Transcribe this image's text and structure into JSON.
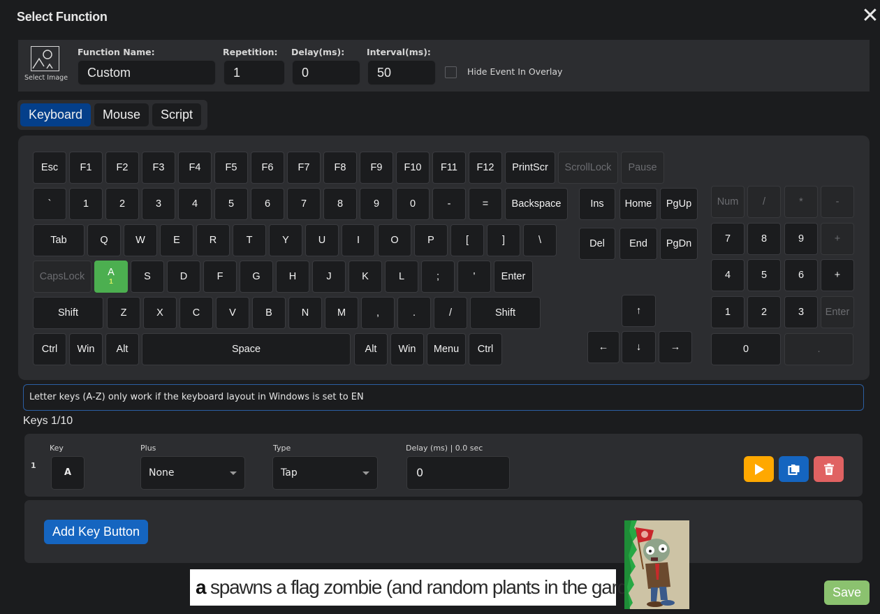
{
  "dialog": {
    "title": "Select Function",
    "close_icon": "close-icon"
  },
  "settings": {
    "select_image_label": "Select Image",
    "function_name_label": "Function Name:",
    "function_name_value": "Custom",
    "repetition_label": "Repetition:",
    "repetition_value": "1",
    "delay_label": "Delay(ms):",
    "delay_value": "0",
    "interval_label": "Interval(ms):",
    "interval_value": "50",
    "hide_event_label": "Hide Event In Overlay",
    "hide_event_checked": false
  },
  "tabs": [
    {
      "label": "Keyboard",
      "active": true
    },
    {
      "label": "Mouse",
      "active": false
    },
    {
      "label": "Script",
      "active": false
    }
  ],
  "keyboard": {
    "keys": [
      {
        "id": "esc",
        "label": "Esc"
      },
      {
        "id": "f1",
        "label": "F1"
      },
      {
        "id": "f2",
        "label": "F2"
      },
      {
        "id": "f3",
        "label": "F3"
      },
      {
        "id": "f4",
        "label": "F4"
      },
      {
        "id": "f5",
        "label": "F5"
      },
      {
        "id": "f6",
        "label": "F6"
      },
      {
        "id": "f7",
        "label": "F7"
      },
      {
        "id": "f8",
        "label": "F8"
      },
      {
        "id": "f9",
        "label": "F9"
      },
      {
        "id": "f10",
        "label": "F10"
      },
      {
        "id": "f11",
        "label": "F11"
      },
      {
        "id": "f12",
        "label": "F12"
      },
      {
        "id": "printscr",
        "label": "PrintScr"
      },
      {
        "id": "scrolllock",
        "label": "ScrollLock",
        "disabled": true
      },
      {
        "id": "pause",
        "label": "Pause",
        "disabled": true
      },
      {
        "id": "backtick",
        "label": "`"
      },
      {
        "id": "1",
        "label": "1"
      },
      {
        "id": "2",
        "label": "2"
      },
      {
        "id": "3",
        "label": "3"
      },
      {
        "id": "4",
        "label": "4"
      },
      {
        "id": "5",
        "label": "5"
      },
      {
        "id": "6",
        "label": "6"
      },
      {
        "id": "7",
        "label": "7"
      },
      {
        "id": "8",
        "label": "8"
      },
      {
        "id": "9",
        "label": "9"
      },
      {
        "id": "0",
        "label": "0"
      },
      {
        "id": "minus",
        "label": "-"
      },
      {
        "id": "equals",
        "label": "="
      },
      {
        "id": "backspace",
        "label": "Backspace"
      },
      {
        "id": "ins",
        "label": "Ins"
      },
      {
        "id": "home",
        "label": "Home"
      },
      {
        "id": "pgup",
        "label": "PgUp"
      },
      {
        "id": "numlock",
        "label": "Num",
        "disabled": true
      },
      {
        "id": "num-divide",
        "label": "/",
        "disabled": true
      },
      {
        "id": "num-multiply",
        "label": "*",
        "disabled": true
      },
      {
        "id": "num-minus",
        "label": "-",
        "disabled": true
      },
      {
        "id": "tab",
        "label": "Tab"
      },
      {
        "id": "q",
        "label": "Q"
      },
      {
        "id": "w",
        "label": "W"
      },
      {
        "id": "e",
        "label": "E"
      },
      {
        "id": "r",
        "label": "R"
      },
      {
        "id": "t",
        "label": "T"
      },
      {
        "id": "y",
        "label": "Y"
      },
      {
        "id": "u",
        "label": "U"
      },
      {
        "id": "i",
        "label": "I"
      },
      {
        "id": "o",
        "label": "O"
      },
      {
        "id": "p",
        "label": "P"
      },
      {
        "id": "lbracket",
        "label": "["
      },
      {
        "id": "rbracket",
        "label": "]"
      },
      {
        "id": "backslash",
        "label": "\\"
      },
      {
        "id": "del",
        "label": "Del"
      },
      {
        "id": "end",
        "label": "End"
      },
      {
        "id": "pgdn",
        "label": "PgDn"
      },
      {
        "id": "num7",
        "label": "7"
      },
      {
        "id": "num8",
        "label": "8"
      },
      {
        "id": "num9",
        "label": "9"
      },
      {
        "id": "num-plus-top",
        "label": "+",
        "disabled": true
      },
      {
        "id": "capslock",
        "label": "CapsLock",
        "disabled": true
      },
      {
        "id": "a",
        "label": "A",
        "selected": true,
        "badge": "1"
      },
      {
        "id": "s",
        "label": "S"
      },
      {
        "id": "d",
        "label": "D"
      },
      {
        "id": "f",
        "label": "F"
      },
      {
        "id": "g",
        "label": "G"
      },
      {
        "id": "h",
        "label": "H"
      },
      {
        "id": "j",
        "label": "J"
      },
      {
        "id": "k",
        "label": "K"
      },
      {
        "id": "l",
        "label": "L"
      },
      {
        "id": "semicolon",
        "label": ";"
      },
      {
        "id": "quote",
        "label": "'"
      },
      {
        "id": "enter",
        "label": "Enter"
      },
      {
        "id": "num4",
        "label": "4"
      },
      {
        "id": "num5",
        "label": "5"
      },
      {
        "id": "num6",
        "label": "6"
      },
      {
        "id": "num-plus",
        "label": "+"
      },
      {
        "id": "lshift",
        "label": "Shift"
      },
      {
        "id": "z",
        "label": "Z"
      },
      {
        "id": "x",
        "label": "X"
      },
      {
        "id": "c",
        "label": "C"
      },
      {
        "id": "v",
        "label": "V"
      },
      {
        "id": "b",
        "label": "B"
      },
      {
        "id": "n",
        "label": "N"
      },
      {
        "id": "m",
        "label": "M"
      },
      {
        "id": "comma",
        "label": ","
      },
      {
        "id": "period",
        "label": "."
      },
      {
        "id": "slash",
        "label": "/"
      },
      {
        "id": "rshift",
        "label": "Shift"
      },
      {
        "id": "up",
        "label": "↑"
      },
      {
        "id": "num1",
        "label": "1"
      },
      {
        "id": "num2",
        "label": "2"
      },
      {
        "id": "num3",
        "label": "3"
      },
      {
        "id": "num-enter",
        "label": "Enter",
        "disabled": true
      },
      {
        "id": "lctrl",
        "label": "Ctrl"
      },
      {
        "id": "lwin",
        "label": "Win"
      },
      {
        "id": "lalt",
        "label": "Alt"
      },
      {
        "id": "space",
        "label": "Space"
      },
      {
        "id": "ralt",
        "label": "Alt"
      },
      {
        "id": "rwin",
        "label": "Win"
      },
      {
        "id": "menu",
        "label": "Menu"
      },
      {
        "id": "rctrl",
        "label": "Ctrl"
      },
      {
        "id": "left",
        "label": "←"
      },
      {
        "id": "down",
        "label": "↓"
      },
      {
        "id": "right",
        "label": "→"
      },
      {
        "id": "num0",
        "label": "0"
      },
      {
        "id": "num-decimal",
        "label": ".",
        "disabled": true
      }
    ]
  },
  "info_message": "Letter keys (A-Z) only work if the keyboard layout in Windows is set to EN",
  "keys_count": "Keys 1/10",
  "key_rows": [
    {
      "index": "1",
      "key_label": "Key",
      "key_value": "A",
      "plus_label": "Plus",
      "plus_value": "None",
      "type_label": "Type",
      "type_value": "Tap",
      "delay_label": "Delay (ms) | 0.0 sec",
      "delay_value": "0",
      "actions": [
        {
          "name": "play",
          "icon": "play-icon",
          "color": "#ffa800"
        },
        {
          "name": "duplicate",
          "icon": "copy-icon",
          "color": "#1565c0"
        },
        {
          "name": "delete",
          "icon": "trash-icon",
          "color": "#e06262"
        }
      ]
    }
  ],
  "add_key_button": "Add Key Button",
  "caption": {
    "bold": "a",
    "text": " spawns a flag zombie (and random plants in the garden)"
  },
  "save_button": "Save",
  "colors": {
    "accent_blue": "#1565c0",
    "tab_active": "#043f8a",
    "selected_key": "#4caf50",
    "save_green": "#8bc26f"
  }
}
